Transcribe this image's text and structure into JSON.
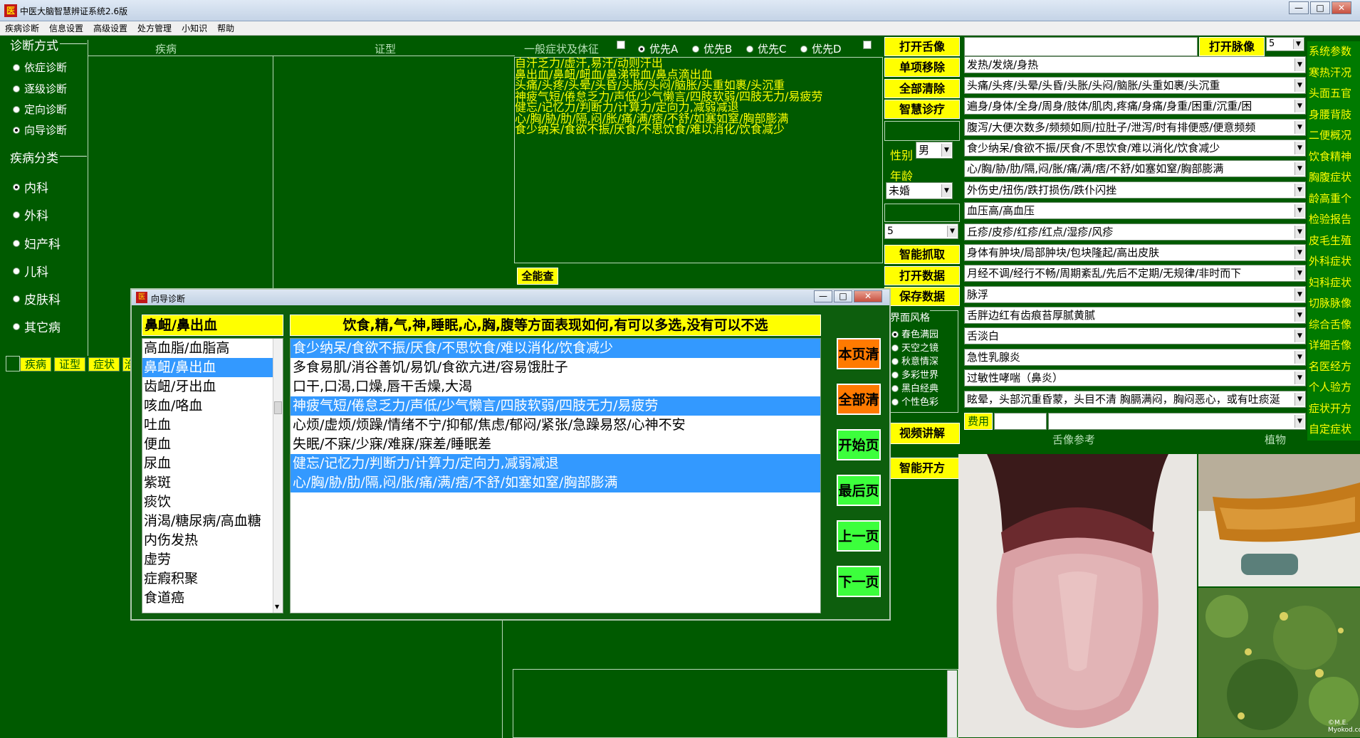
{
  "window": {
    "title": "中医大脑智慧辨证系统2.6版",
    "app_icon": "医"
  },
  "menu": [
    "疾病诊断",
    "信息设置",
    "高级设置",
    "处方管理",
    "小知识",
    "帮助"
  ],
  "diag_mode": {
    "title": "诊断方式",
    "options": [
      {
        "label": "依症诊断",
        "checked": false
      },
      {
        "label": "逐级诊断",
        "checked": false
      },
      {
        "label": "定向诊断",
        "checked": false
      },
      {
        "label": "向导诊断",
        "checked": true
      }
    ]
  },
  "disease_cat": {
    "title": "疾病分类",
    "options": [
      {
        "label": "内科",
        "checked": true
      },
      {
        "label": "外科",
        "checked": false
      },
      {
        "label": "妇产科",
        "checked": false
      },
      {
        "label": "儿科",
        "checked": false
      },
      {
        "label": "皮肤科",
        "checked": false
      },
      {
        "label": "其它病",
        "checked": false
      }
    ]
  },
  "bottom_tabs": [
    "疾病",
    "证型",
    "症状",
    "治"
  ],
  "columns": {
    "disease": "疾病",
    "syndrome": "证型"
  },
  "general": {
    "header": "一般症状及体征",
    "priorities": [
      "优先A",
      "优先B",
      "优先C",
      "优先D"
    ],
    "symptom_lines": [
      "自汗乏力/虚汗,易汗/动则汗出",
      "鼻出血/鼻衄/衄血/鼻涕带血/鼻点滴出血",
      "头痛/头疼/头晕/头昏/头胀/头闷/脑胀/头重如裹/头沉重",
      "神疲气短/倦怠乏力/声低/少气懒言/四肢软弱/四肢无力/易疲劳",
      "健忘/记忆力/判断力/计算力/定向力,减弱减退",
      "心/胸/胁/肋/隔,闷/胀/痛/满/痞/不舒/如塞如窒/胸部膨满",
      "食少纳呆/食欲不振/厌食/不思饮食/难以消化/饮食减少"
    ],
    "query_button": "全能查"
  },
  "mid_buttons": [
    "打开舌像",
    "单项移除",
    "全部清除",
    "智慧诊疗"
  ],
  "patient": {
    "gender_label": "性别",
    "gender": "男",
    "age_label": "年龄",
    "marital": "未婚",
    "count": "5"
  },
  "mid_buttons2": [
    "智能抓取",
    "打开数据",
    "保存数据"
  ],
  "style": {
    "title": "界面风格",
    "options": [
      {
        "label": "春色满园",
        "checked": true
      },
      {
        "label": "天空之镜",
        "checked": false
      },
      {
        "label": "秋意情深",
        "checked": false
      },
      {
        "label": "多彩世界",
        "checked": false
      },
      {
        "label": "黑白经典",
        "checked": false
      },
      {
        "label": "个性色彩",
        "checked": false
      }
    ]
  },
  "mid_buttons3": [
    "视频讲解",
    "智能开方"
  ],
  "pulse": {
    "button": "打开脉像",
    "value": "5"
  },
  "symptom_combos": [
    "发热/发烧/身热",
    "头痛/头疼/头晕/头昏/头胀/头闷/脑胀/头重如裹/头沉重",
    "遍身/身体/全身/周身/肢体/肌肉,疼痛/身痛/身重/困重/沉重/困",
    "腹泻/大便次数多/频频如厕/拉肚子/泄泻/时有排便感/便意频频",
    "食少纳呆/食欲不振/厌食/不思饮食/难以消化/饮食减少",
    "心/胸/胁/肋/隔,闷/胀/痛/满/痞/不舒/如塞如窒/胸部膨满",
    "外伤史/扭伤/跌打损伤/跌仆闪挫",
    "血压高/高血压",
    "丘疹/皮疹/红疹/红点/湿疹/风疹",
    "身体有肿块/局部肿块/包块隆起/高出皮肤",
    "月经不调/经行不畅/周期紊乱/先后不定期/无规律/非时而下",
    "脉浮",
    "舌胖边红有齿痕苔厚腻黄腻",
    "舌淡白",
    "急性乳腺炎",
    "过敏性哮喘（鼻炎）",
    "眩晕，头部沉重昏蒙，头目不清 胸膈满闷，胸闷恶心，或有吐痰涎"
  ],
  "fee": {
    "label": "费用",
    "value": ""
  },
  "right_labels": [
    "系统参数",
    "寒热汗况",
    "头面五官",
    "身腰背肢",
    "二便概况",
    "饮食精神",
    "胸腹症状",
    "龄高重个",
    "检验报告",
    "皮毛生殖",
    "外科症状",
    "妇科症状",
    "切脉脉像",
    "综合舌像",
    "详细舌像",
    "名医经方",
    "个人验方",
    "症状开方",
    "自定症状"
  ],
  "image_captions": {
    "tongue": "舌像参考",
    "plant": "植物"
  },
  "watermark": "©M.E.\nMyokod.com",
  "dialog": {
    "title": "向导诊断",
    "icon": "医",
    "selected": "鼻衄/鼻出血",
    "question": "饮食,精,气,神,睡眠,心,胸,腹等方面表现如何,有可以多选,没有可以不选",
    "disease_list": [
      {
        "label": "高血脂/血脂高",
        "selected": false
      },
      {
        "label": "鼻衄/鼻出血",
        "selected": true
      },
      {
        "label": "齿衄/牙出血",
        "selected": false
      },
      {
        "label": "咳血/咯血",
        "selected": false
      },
      {
        "label": "吐血",
        "selected": false
      },
      {
        "label": "便血",
        "selected": false
      },
      {
        "label": "尿血",
        "selected": false
      },
      {
        "label": "紫斑",
        "selected": false
      },
      {
        "label": "痰饮",
        "selected": false
      },
      {
        "label": "消渴/糖尿病/高血糖",
        "selected": false
      },
      {
        "label": "内伤发热",
        "selected": false
      },
      {
        "label": "虚劳",
        "selected": false
      },
      {
        "label": "症瘕积聚",
        "selected": false
      },
      {
        "label": "食道癌",
        "selected": false
      }
    ],
    "symptoms": [
      {
        "label": "食少纳呆/食欲不振/厌食/不思饮食/难以消化/饮食减少",
        "selected": true
      },
      {
        "label": "多食易肌/消谷善饥/易饥/食欲亢进/容易饿肚子",
        "selected": false
      },
      {
        "label": "口干,口渴,口燥,唇干舌燥,大渴",
        "selected": false
      },
      {
        "label": "神疲气短/倦怠乏力/声低/少气懒言/四肢软弱/四肢无力/易疲劳",
        "selected": true
      },
      {
        "label": "心烦/虚烦/烦躁/情绪不宁/抑郁/焦虑/郁闷/紧张/急躁易怒/心神不安",
        "selected": false
      },
      {
        "label": "失眠/不寐/少寐/难寐/寐差/睡眠差",
        "selected": false
      },
      {
        "label": "健忘/记忆力/判断力/计算力/定向力,减弱减退",
        "selected": true
      },
      {
        "label": "心/胸/胁/肋/隔,闷/胀/痛/满/痞/不舒/如塞如窒/胸部膨满",
        "selected": true
      }
    ],
    "buttons": [
      "本页清",
      "全部清",
      "开始页",
      "最后页",
      "上一页",
      "下一页"
    ],
    "button_colors": [
      "#ff7a00",
      "#ff7a00",
      "#3cff3c",
      "#3cff3c",
      "#3cff3c",
      "#3cff3c"
    ]
  }
}
